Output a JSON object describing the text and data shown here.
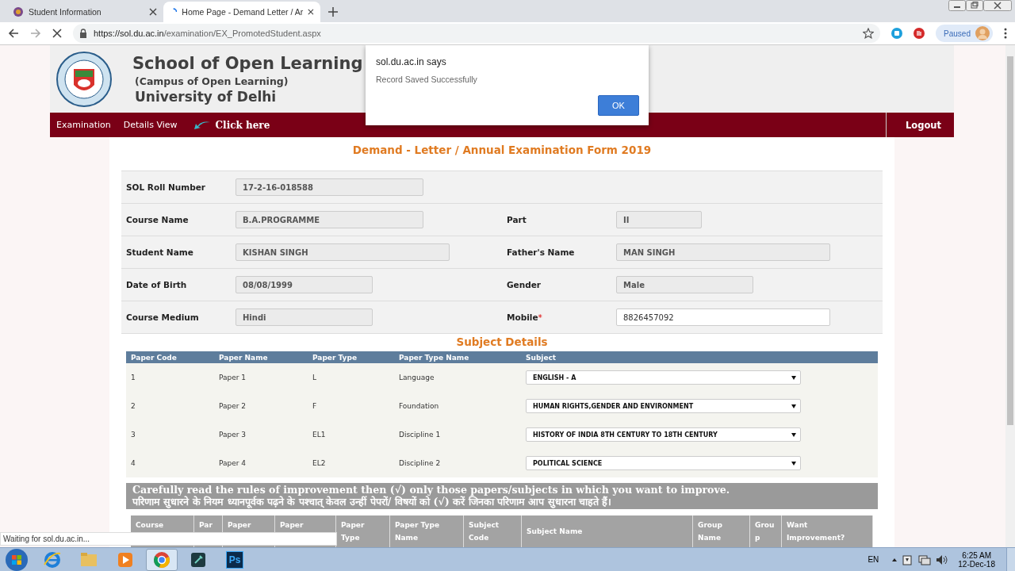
{
  "browser": {
    "tabs": [
      {
        "title": "Student Information",
        "selected": false,
        "loading": false
      },
      {
        "title": "Home Page - Demand Letter / Ar",
        "selected": true,
        "loading": true
      }
    ],
    "url_host": "https://sol.du.ac.in",
    "url_path": "/examination/EX_PromotedStudent.aspx",
    "profile_label": "Paused",
    "loading": true
  },
  "header": {
    "title": "School of Open Learning",
    "subtitle": "(Campus of Open Learning)",
    "university": "University of Delhi"
  },
  "nav": {
    "items": [
      "Examination",
      "Details View"
    ],
    "click_here": "Click here",
    "logout": "Logout"
  },
  "form": {
    "title": "Demand - Letter / Annual Examination Form 2019",
    "rows": [
      {
        "label": "SOL Roll Number",
        "value": "17-2-16-018588",
        "editable": false
      },
      {
        "label": "Course Name",
        "value": "B.A.PROGRAMME",
        "editable": false,
        "right": {
          "label": "Part",
          "value": "II",
          "editable": false
        }
      },
      {
        "label": "Student Name",
        "value": "KISHAN SINGH",
        "editable": false,
        "right": {
          "label": "Father's Name",
          "value": "MAN SINGH",
          "editable": false
        }
      },
      {
        "label": "Date of Birth",
        "value": "08/08/1999",
        "editable": false,
        "right": {
          "label": "Gender",
          "value": "Male",
          "editable": false
        }
      },
      {
        "label": "Course Medium",
        "value": "Hindi",
        "editable": false,
        "right": {
          "label": "Mobile",
          "marker": "*",
          "value": "8826457092",
          "editable": true
        }
      }
    ]
  },
  "subjects": {
    "title": "Subject Details",
    "columns": [
      "Paper Code",
      "Paper Name",
      "Paper Type",
      "Paper Type Name",
      "Subject"
    ],
    "rows": [
      [
        "1",
        "Paper 1",
        "L",
        "Language",
        "ENGLISH - A"
      ],
      [
        "2",
        "Paper 2",
        "F",
        "Foundation",
        "HUMAN RIGHTS,GENDER AND ENVIRONMENT"
      ],
      [
        "3",
        "Paper 3",
        "EL1",
        "Discipline 1",
        "HISTORY OF INDIA 8TH CENTURY TO 18TH CENTURY"
      ],
      [
        "4",
        "Paper 4",
        "EL2",
        "Discipline 2",
        "POLITICAL SCIENCE"
      ]
    ]
  },
  "notice": [
    "Carefully read the rules of improvement then (√) only those papers/subjects in which you want to improve.",
    "परिणाम सुधारने के नियम ध्यानपूर्वक पढ़ने के पश्चात् केवल उन्हीं पेपरों/ विषयों को (√) करें जिनका परिणाम आप सुधारना चाहते हैं।"
  ],
  "improvement_table": {
    "columns": [
      "Course",
      "Par",
      "Paper",
      "Paper",
      "Paper Type",
      "Paper Type Name",
      "Subject Code",
      "Subject Name",
      "Group Name",
      "Group",
      "Want Improvement?"
    ]
  },
  "dialog": {
    "origin": "sol.du.ac.in says",
    "message": "Record Saved Successfully",
    "button": "OK"
  },
  "status_bar": "Waiting for sol.du.ac.in...",
  "taskbar": {
    "apps": [
      {
        "kind": "ie",
        "selected": false
      },
      {
        "kind": "folder",
        "selected": false
      },
      {
        "kind": "media",
        "selected": false
      },
      {
        "kind": "chrome",
        "selected": true
      },
      {
        "kind": "editor",
        "selected": false
      },
      {
        "kind": "photoshop",
        "label": "Ps",
        "selected": false
      }
    ],
    "language": "EN",
    "time": "6:25 AM",
    "date": "12-Dec-18"
  }
}
